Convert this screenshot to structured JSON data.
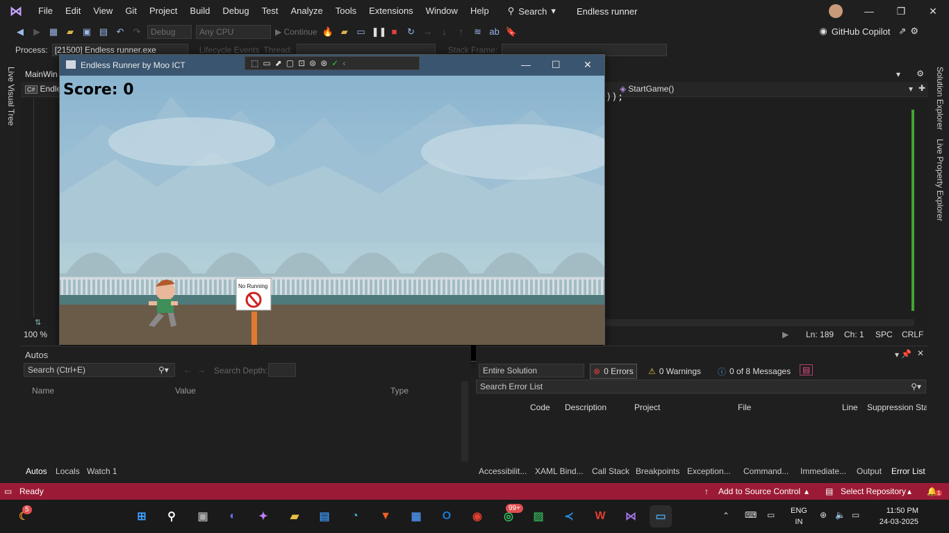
{
  "menubar": {
    "items": [
      "File",
      "Edit",
      "View",
      "Git",
      "Project",
      "Build",
      "Debug",
      "Test",
      "Analyze",
      "Tools",
      "Extensions",
      "Window",
      "Help"
    ],
    "search_label": "Search",
    "project_title": "Endless runner"
  },
  "toolbar": {
    "config": "Debug",
    "platform": "Any CPU",
    "continue_label": "Continue",
    "copilot_label": "GitHub Copilot"
  },
  "procbar": {
    "process_label": "Process:",
    "process_value": "[21500] Endless runner.exe",
    "lifecycle_label": "Lifecycle Events",
    "thread_label": "Thread:",
    "stackframe_label": "Stack Frame:"
  },
  "side": {
    "left_tab": "Live Visual Tree",
    "right_tab_1": "Solution Explorer",
    "right_tab_2": "Live Property Explorer"
  },
  "editor": {
    "tab": "MainWin",
    "file_nav": "Endles",
    "method_nav": "StartGame()",
    "code_fragment": "));",
    "zoom": "100 %",
    "line": "Ln: 189",
    "col": "Ch: 1",
    "spc": "SPC",
    "crlf": "CRLF"
  },
  "game": {
    "window_title": "Endless Runner by Moo ICT",
    "score_text": "Score: 0",
    "sign_text": "No Running"
  },
  "autos": {
    "title": "Autos",
    "search_placeholder": "Search (Ctrl+E)",
    "search_depth": "Search Depth:",
    "columns": [
      "Name",
      "Value",
      "Type"
    ],
    "tabs": [
      "Autos",
      "Locals",
      "Watch 1"
    ]
  },
  "errors": {
    "scope": "Entire Solution",
    "errors": "0 Errors",
    "warnings": "0 Warnings",
    "messages": "0 of 8 Messages",
    "search_placeholder": "Search Error List",
    "columns": [
      "Code",
      "Description",
      "Project",
      "File",
      "Line",
      "Suppression Stat"
    ],
    "tabs": [
      "Accessibilit...",
      "XAML Bind...",
      "Call Stack",
      "Breakpoints",
      "Exception...",
      "Command...",
      "Immediate...",
      "Output",
      "Error List"
    ]
  },
  "statusbar": {
    "ready": "Ready",
    "source_control": "Add to Source Control",
    "repository": "Select Repository",
    "notif_count": "1"
  },
  "taskbar": {
    "weather_badge": "5",
    "whatsapp_badge": "99+",
    "lang_line1": "ENG",
    "lang_line2": "IN",
    "time": "11:50 PM",
    "date": "24-03-2025"
  },
  "colors": {
    "status_bar": "#9b1b36",
    "accent_green": "#42a52f"
  }
}
